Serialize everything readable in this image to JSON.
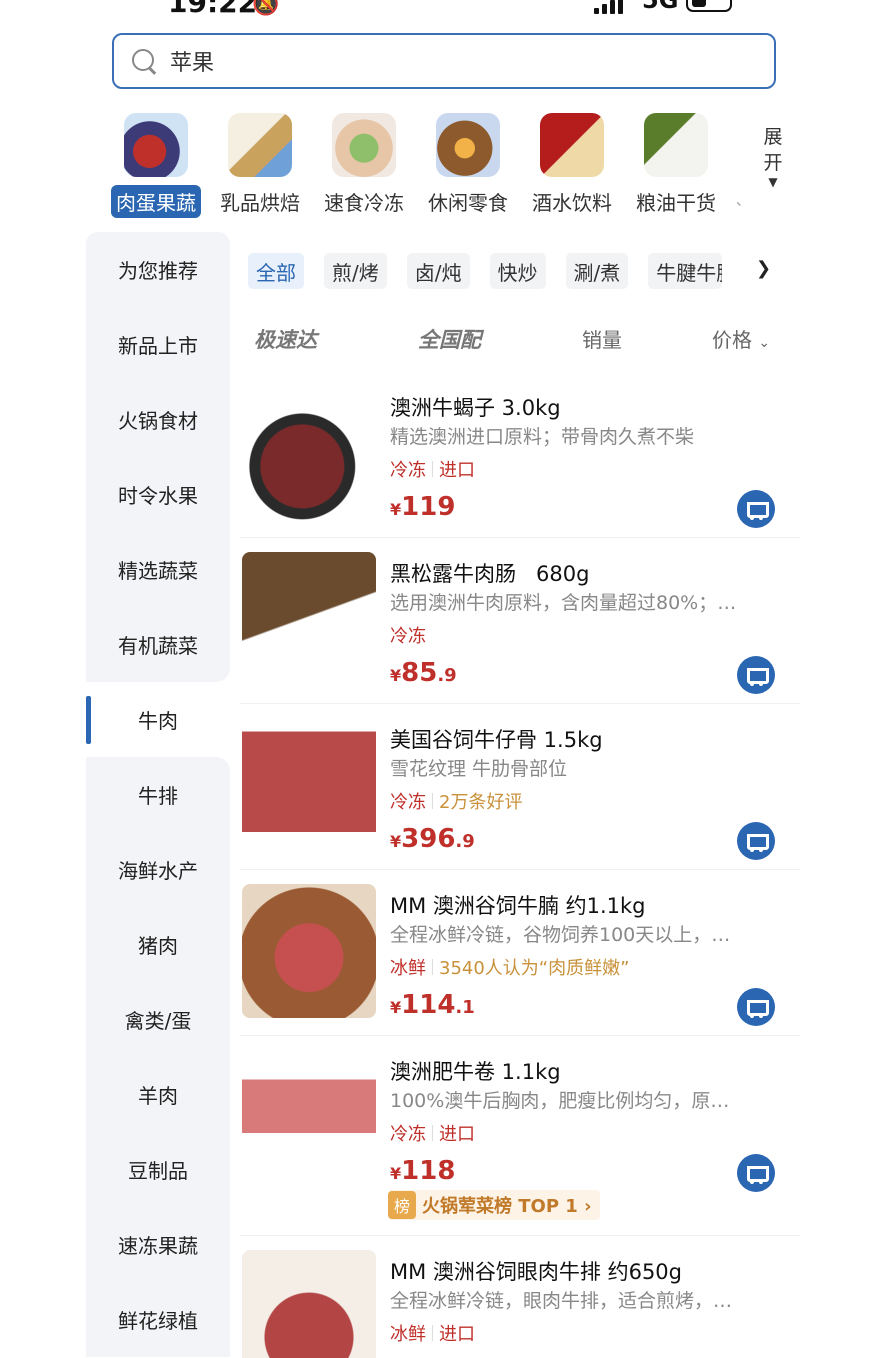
{
  "status_bar": {
    "time": "19:22",
    "network": "5G"
  },
  "search": {
    "value": "苹果"
  },
  "categories": [
    {
      "label": "肉蛋果蔬",
      "icon": "fruit-veg-icon",
      "active": true
    },
    {
      "label": "乳品烘焙",
      "icon": "dairy-bakery-icon",
      "active": false
    },
    {
      "label": "速食冷冻",
      "icon": "frozen-food-icon",
      "active": false
    },
    {
      "label": "休闲零食",
      "icon": "snack-icon",
      "active": false
    },
    {
      "label": "酒水饮料",
      "icon": "drinks-icon",
      "active": false
    },
    {
      "label": "粮油干货",
      "icon": "grain-oil-icon",
      "active": false
    }
  ],
  "expand_label": "展开",
  "sidenav": [
    "为您推荐",
    "新品上市",
    "火锅食材",
    "时令水果",
    "精选蔬菜",
    "有机蔬菜",
    "牛肉",
    "牛排",
    "海鲜水产",
    "猪肉",
    "禽类/蛋",
    "羊肉",
    "豆制品",
    "速冻果蔬",
    "鲜花绿植"
  ],
  "sidenav_active": "牛肉",
  "filter_chips": [
    "全部",
    "煎/烤",
    "卤/炖",
    "快炒",
    "涮/煮",
    "牛腱牛腩"
  ],
  "sort_bar": {
    "express": "极速达",
    "nationwide": "全国配",
    "sales": "销量",
    "price": "价格"
  },
  "products": [
    {
      "name": "澳洲牛蝎子 3.0kg",
      "desc": "精选澳洲进口原料；带骨肉久煮不柴",
      "tag1": "冷冻",
      "tag2": "进口",
      "tag2_style": "red",
      "price_int": "119",
      "price_dec": ""
    },
    {
      "name": "黑松露牛肉肠   680g",
      "desc": "选用澳洲牛肉原料，含肉量超过80%；…",
      "tag1": "冷冻",
      "tag2": "",
      "tag2_style": "red",
      "price_int": "85",
      "price_dec": ".9"
    },
    {
      "name": "美国谷饲牛仔骨 1.5kg",
      "desc": "雪花纹理 牛肋骨部位",
      "tag1": "冷冻",
      "tag2": "2万条好评",
      "tag2_style": "gold",
      "price_int": "396",
      "price_dec": ".9"
    },
    {
      "name": "MM 澳洲谷饲牛腩 约1.1kg",
      "desc": "全程冰鲜冷链，谷物饲养100天以上，…",
      "tag1": "冰鲜",
      "tag2": "3540人认为“肉质鲜嫩”",
      "tag2_style": "gold",
      "price_int": "114",
      "price_dec": ".1"
    },
    {
      "name": "澳洲肥牛卷 1.1kg",
      "desc": "100%澳牛后胸肉，肥瘦比例均匀，原…",
      "tag1": "冷冻",
      "tag2": "进口",
      "tag2_style": "red",
      "price_int": "118",
      "price_dec": "",
      "rank_badge": "榜",
      "rank_text": "火锅荤菜榜 TOP 1 ›"
    },
    {
      "name": "MM 澳洲谷饲眼肉牛排 约650g",
      "desc": "全程冰鲜冷链，眼肉牛排，适合煎烤，…",
      "tag1": "冰鲜",
      "tag2": "进口",
      "tag2_style": "red",
      "price_int": "",
      "price_dec": ""
    }
  ],
  "currency_symbol": "¥",
  "colors": {
    "accent": "#2a66b1",
    "price": "#c0302b",
    "gold": "#c8913a"
  }
}
